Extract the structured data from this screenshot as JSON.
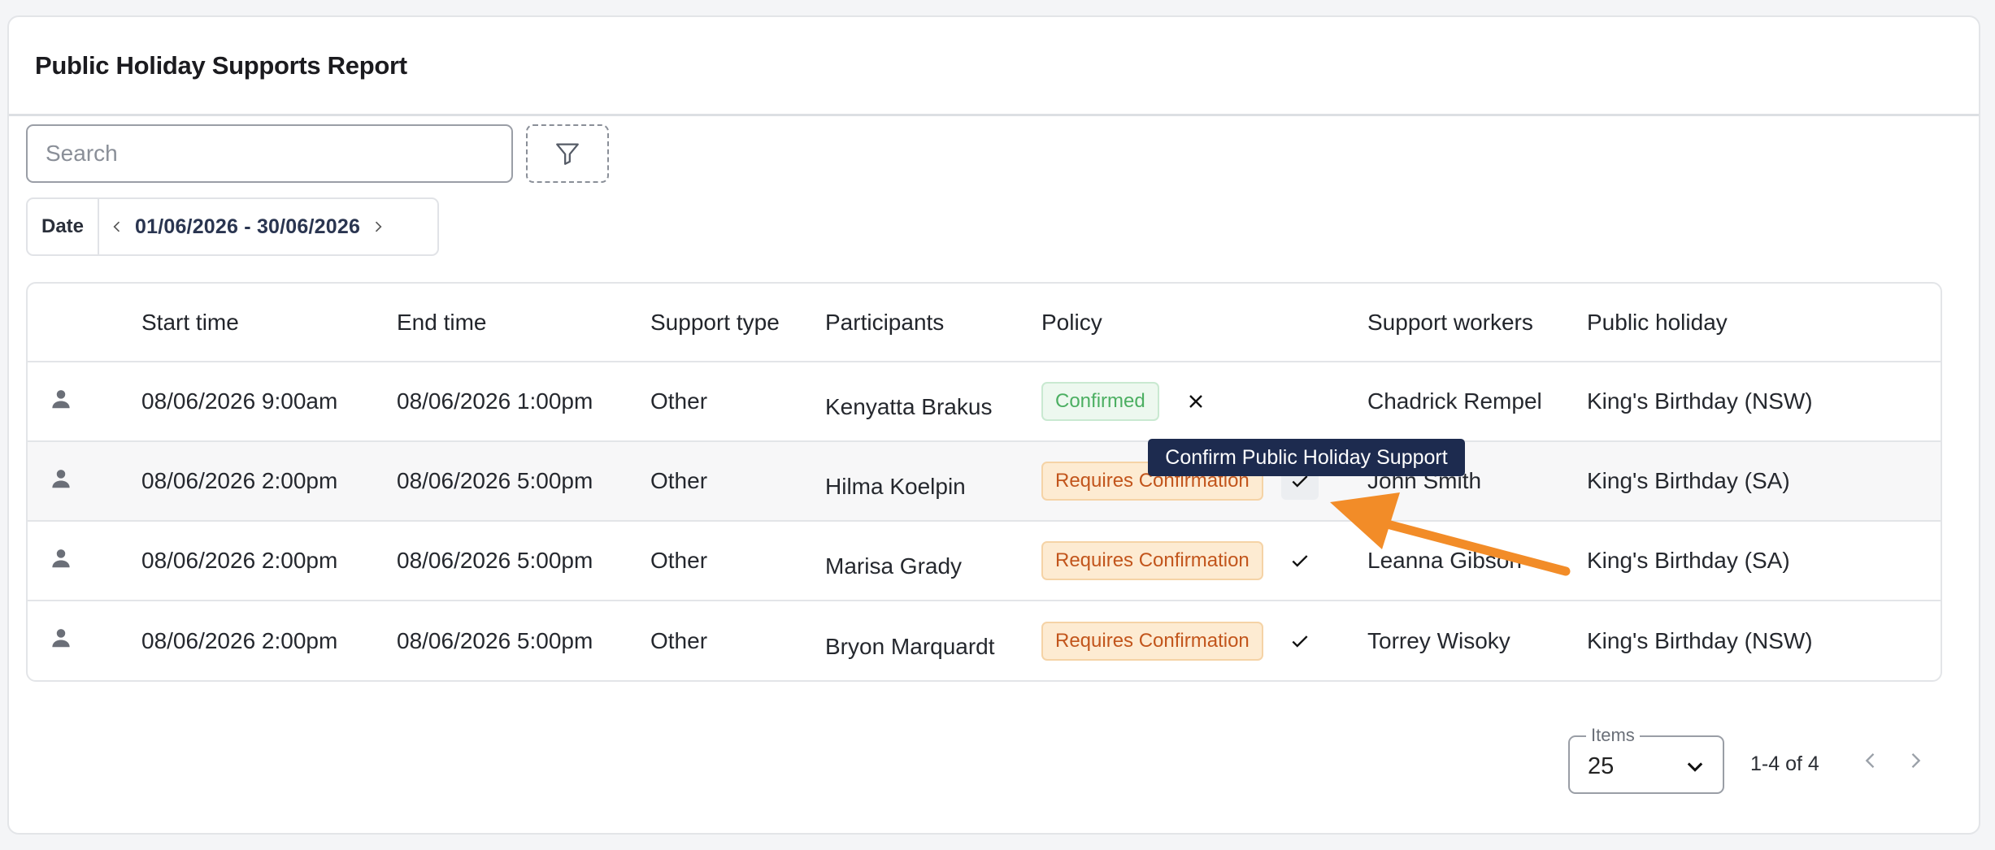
{
  "page": {
    "title": "Public Holiday Supports Report"
  },
  "search": {
    "placeholder": "Search",
    "value": ""
  },
  "date_filter": {
    "label": "Date",
    "range": "01/06/2026 - 30/06/2026"
  },
  "table": {
    "headers": [
      "",
      "Start time",
      "End time",
      "Support type",
      "Participants",
      "Policy",
      "Support workers",
      "Public holiday"
    ],
    "rows": [
      {
        "icon": "person-icon",
        "start": "08/06/2026 9:00am",
        "end": "08/06/2026 1:00pm",
        "type": "Other",
        "participant": "Kenyatta Brakus",
        "policy": "Confirmed",
        "action": "close-icon",
        "worker": "Chadrick Rempel",
        "holiday": "King's Birthday (NSW)"
      },
      {
        "icon": "person-icon",
        "start": "08/06/2026 2:00pm",
        "end": "08/06/2026 5:00pm",
        "type": "Other",
        "participant": "Hilma Koelpin",
        "policy": "Requires Confirmation",
        "action": "check-icon",
        "worker": "John Smith",
        "holiday": "King's Birthday (SA)"
      },
      {
        "icon": "person-icon",
        "start": "08/06/2026 2:00pm",
        "end": "08/06/2026 5:00pm",
        "type": "Other",
        "participant": "Marisa Grady",
        "policy": "Requires Confirmation",
        "action": "check-icon",
        "worker": "Leanna Gibson",
        "holiday": "King's Birthday (SA)"
      },
      {
        "icon": "person-icon",
        "start": "08/06/2026 2:00pm",
        "end": "08/06/2026 5:00pm",
        "type": "Other",
        "participant": "Bryon Marquardt",
        "policy": "Requires Confirmation",
        "action": "check-icon",
        "worker": "Torrey Wisoky",
        "holiday": "King's Birthday (NSW)"
      }
    ]
  },
  "tooltip": {
    "text": "Confirm Public Holiday Support"
  },
  "pagination": {
    "items_label": "Items",
    "items_value": "25",
    "range_text": "1-4 of 4"
  },
  "colors": {
    "confirmed": "#4caf62",
    "requires_confirmation": "#c2551c",
    "tooltip_bg": "#1d2b4f",
    "annotation_arrow": "#f28c28"
  }
}
